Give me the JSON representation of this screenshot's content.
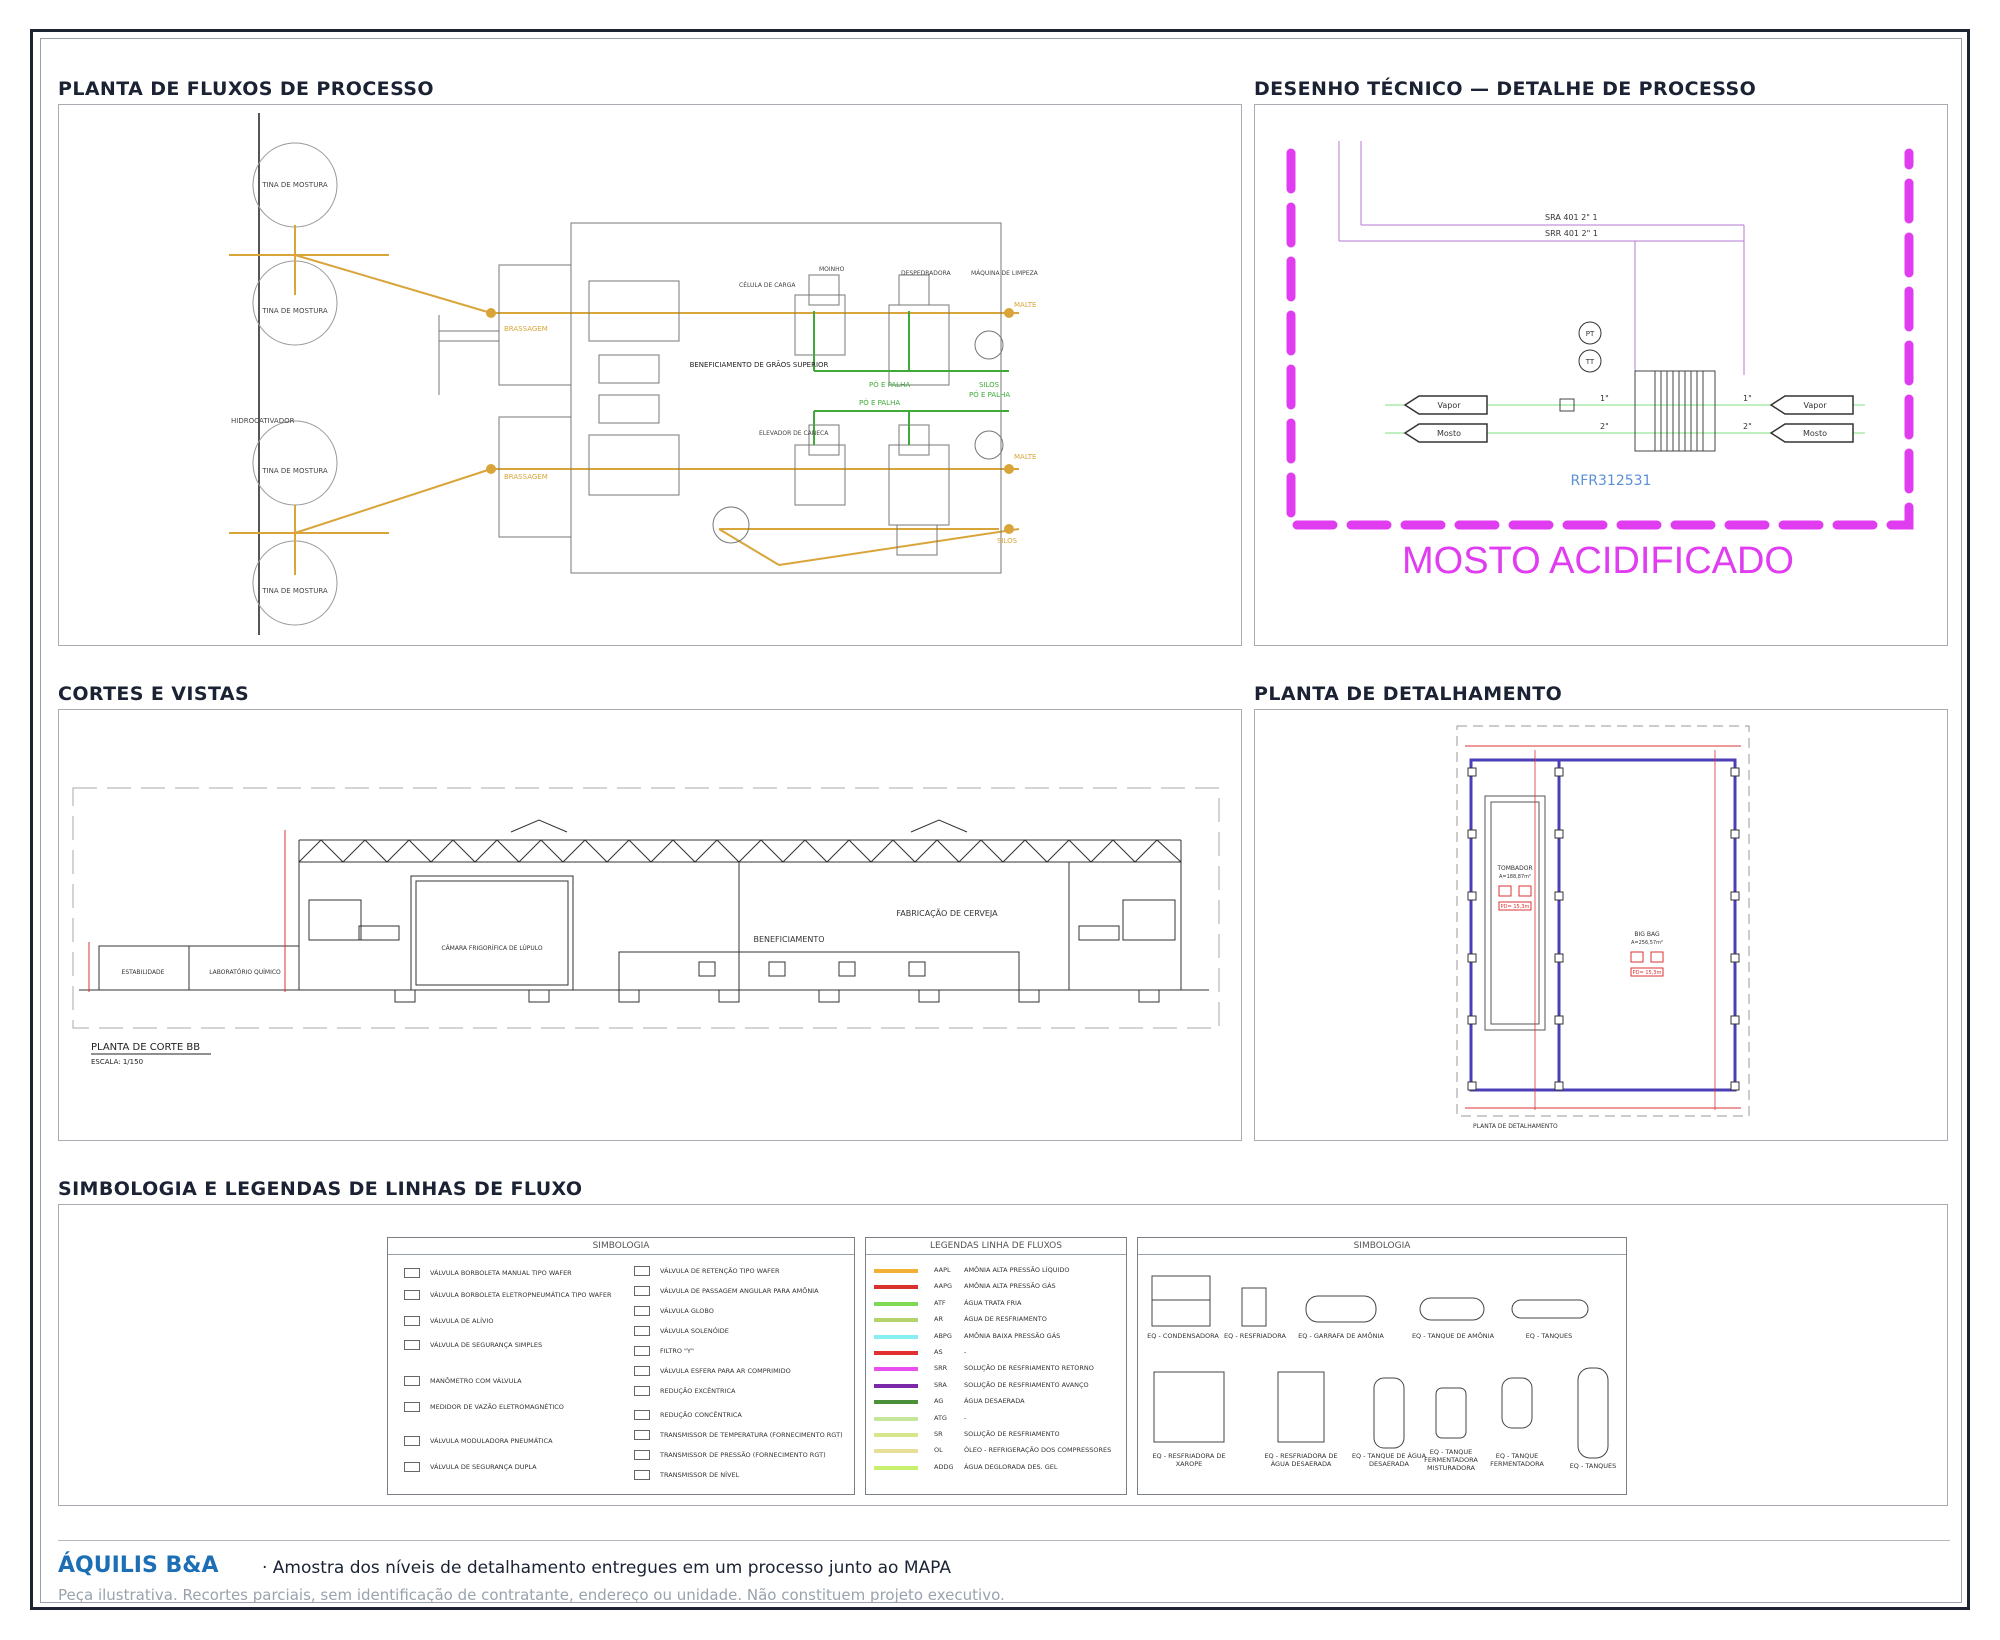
{
  "sections": {
    "process_flow": {
      "title": "PLANTA DE FLUXOS DE PROCESSO",
      "labels": {
        "tina_1": "TINA DE MOSTURA",
        "tina_2": "TINA DE MOSTURA",
        "tina_3": "TINA DE MOSTURA",
        "tina_4": "TINA DE MOSTURA",
        "hidrocativador": "HIDROCATIVADOR",
        "brassagem_1": "BRASSAGEM",
        "brassagem_2": "BRASSAGEM",
        "beneficiamento": "BENEFICIAMENTO DE GRÃOS SUPERIOR",
        "malte_1": "MALTE",
        "malte_2": "MALTE",
        "silos_1": "SILOS",
        "silos_2": "SILOS",
        "po_palha_1": "PÓ E PALHA",
        "po_palha_2": "PÓ E PALHA",
        "po_palha_3": "PÓ E PALHA",
        "celula_carga": "CÉLULA DE CARGA",
        "elevador_caneca": "ELEVADOR DE CANECA",
        "moinho": "MOINHO",
        "despedradora": "DESPEDRADORA",
        "maquina_limpeza": "MÁQUINA DE LIMPEZA"
      }
    },
    "technical_drawing": {
      "title": "DESENHO TÉCNICO — DETALHE DE PROCESSO",
      "line_sra": "SRA  401  2\"  1",
      "line_srr": "SRR  401  2\"  1",
      "pt": "PT",
      "tt": "TT",
      "size_1": "1\"",
      "size_2": "2\"",
      "size_3": "1\"",
      "size_4": "2\"",
      "vapor_left": "Vapor",
      "mosto_left": "Mosto",
      "vapor_right": "Vapor",
      "mosto_right": "Mosto",
      "tag": "RFR312531",
      "big_label": "MOSTO  ACIDIFICADO"
    },
    "sections_views": {
      "title": "CORTES E VISTAS",
      "estabilidade": "ESTABILIDADE",
      "laboratorio": "LABORATÓRIO QUÍMICO",
      "camara": "CÂMARA FRIGORÍFICA DE LÚPULO",
      "beneficiamento": "BENEFICIAMENTO",
      "fabricacao": "FABRICAÇÃO DE CERVEJA",
      "caption": "PLANTA DE CORTE BB",
      "scale": "ESCALA: 1/150"
    },
    "detail_plan": {
      "title": "PLANTA DE DETALHAMENTO",
      "tombador": "TOMBADOR",
      "tombador_area": "A=188,87m²",
      "big_bag": "BIG BAG",
      "big_bag_area": "A=256,57m²",
      "pd_1": "PD= 15,3m",
      "pd_2": "PD= 15,3m",
      "caption": "PLANTA DE DETALHAMENTO"
    },
    "legends": {
      "title": "SIMBOLOGIA E LEGENDAS DE LINHAS DE FLUXO",
      "symbols_head": "SIMBOLOGIA",
      "symbols_left": [
        "VÁLVULA BORBOLETA MANUAL TIPO WAFER",
        "VÁLVULA BORBOLETA ELETROPNEUMÁTICA TIPO WAFER",
        "VÁLVULA DE ALÍVIO",
        "VÁLVULA DE SEGURANÇA SIMPLES",
        "MANÔMETRO COM VÁLVULA",
        "MEDIDOR DE VAZÃO ELETROMAGNÉTICO",
        "VÁLVULA MODULADORA PNEUMÁTICA",
        "VÁLVULA DE SEGURANÇA DUPLA"
      ],
      "symbols_right": [
        "VÁLVULA DE RETENÇÃO TIPO WAFER",
        "VÁLVULA DE PASSAGEM ANGULAR PARA AMÔNIA",
        "VÁLVULA GLOBO",
        "VÁLVULA SOLENÓIDE",
        "FILTRO \"Y\"",
        "VÁLVULA ESFERA PARA AR COMPRIMIDO",
        "REDUÇÃO EXCÊNTRICA",
        "REDUÇÃO CONCÊNTRICA",
        "TRANSMISSOR DE TEMPERATURA (FORNECIMENTO RGT)",
        "TRANSMISSOR DE PRESSÃO (FORNECIMENTO RGT)",
        "TRANSMISSOR DE NÍVEL"
      ],
      "flow_head": "LEGENDAS  LINHA  DE  FLUXOS",
      "flow_lines": [
        {
          "code": "AAPL",
          "desc": "AMÔNIA ALTA PRESSÃO LÍQUIDO",
          "color": "#f2b134"
        },
        {
          "code": "AAPG",
          "desc": "AMÔNIA ALTA PRESSÃO GÁS",
          "color": "#d9342b"
        },
        {
          "code": "ATF",
          "desc": "ÁGUA TRATA FRIA",
          "color": "#7ed957"
        },
        {
          "code": "AR",
          "desc": "ÁGUA DE RESFRIAMENTO",
          "color": "#b5d36b"
        },
        {
          "code": "ABPG",
          "desc": "AMÔNIA BAIXA PRESSÃO GÁS",
          "color": "#86f0f0"
        },
        {
          "code": "AS",
          "desc": "-",
          "color": "#e03030"
        },
        {
          "code": "SRR",
          "desc": "SOLUÇÃO DE RESFRIAMENTO RETORNO",
          "color": "#e84ef0"
        },
        {
          "code": "SRA",
          "desc": "SOLUÇÃO DE RESFRIAMENTO AVANÇO",
          "color": "#7a2aa8"
        },
        {
          "code": "AG",
          "desc": "ÁGUA DESAERADA",
          "color": "#4a8f3a"
        },
        {
          "code": "ATG",
          "desc": "-",
          "color": "#c4e59a"
        },
        {
          "code": "SR",
          "desc": "SOLUÇÃO DE RESFRIAMENTO",
          "color": "#d6e68a"
        },
        {
          "code": "OL",
          "desc": "ÓLEO - REFRIGERAÇÃO DOS COMPRESSORES",
          "color": "#e6df9a"
        },
        {
          "code": "ADDG",
          "desc": "ÁGUA DEGLORADA DES. GEL",
          "color": "#c8f06e"
        }
      ],
      "equip_head": "SIMBOLOGIA",
      "equip_top": [
        "EQ - CONDENSADORA",
        "EQ - RESFRIADORA",
        "EQ - GARRAFA DE AMÔNIA",
        "EQ - TANQUE DE AMÔNIA",
        "EQ - TANQUES"
      ],
      "equip_bottom": [
        "EQ - RESFRIADORA DE XAROPE",
        "EQ - RESFRIADORA DE ÁGUA DESAERADA",
        "EQ - TANQUE DE ÁGUA DESAERADA",
        "EQ - TANQUE FERMENTADORA MISTURADORA",
        "EQ - TANQUE FERMENTADORA",
        "EQ - TANQUES"
      ]
    }
  },
  "footer": {
    "brand": "ÁQUILIS B&A",
    "tagline": "· Amostra dos níveis de detalhamento entregues em um processo junto ao MAPA",
    "disclaimer": "Peça ilustrativa. Recortes parciais, sem identificação de contratante, endereço ou unidade. Não constituem projeto executivo."
  },
  "colors": {
    "brand": "#1d6fb5",
    "magenta": "#e03cf0",
    "flow_gold": "#d9a53a",
    "flow_green": "#3faa3a",
    "blue_tag": "#5b8fd6",
    "purple_wall": "#4b3fb8"
  }
}
